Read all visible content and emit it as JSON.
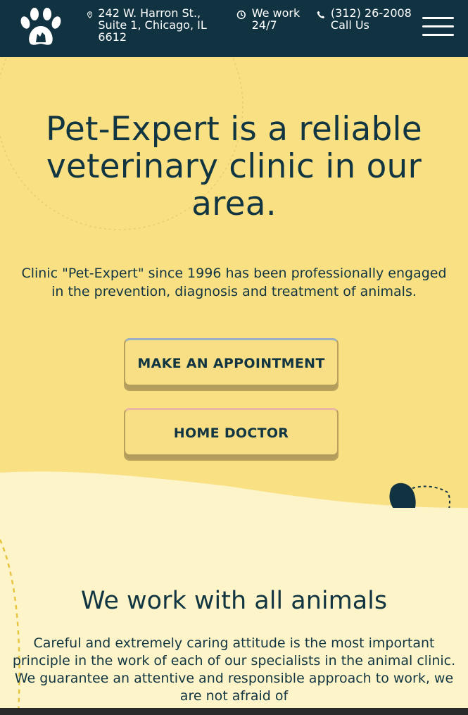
{
  "header": {
    "logo_icon": "paw-pets-logo",
    "address": "242 W. Harron St., Suite 1, Chicago, IL 6612",
    "hours": "We work 24/7",
    "phone": "(312) 26-2008 Call Us",
    "icons": {
      "address": "map-pin-icon",
      "hours": "clock-icon",
      "phone": "phone-icon",
      "menu": "hamburger-menu-icon"
    },
    "background": "#113341"
  },
  "hero": {
    "title": "Pet-Expert is a reliable veterinary clinic in our area.",
    "lead": "Clinic \"Pet-Expert\" since 1996 has been professionally engaged in the prevention, diagnosis and treatment of animals.",
    "buttons": {
      "appointment": "MAKE AN APPOINTMENT",
      "home_doctor": "HOME DOCTOR"
    },
    "background": "#f9e083"
  },
  "section": {
    "title": "We work with all animals",
    "body": "Careful and extremely caring attitude is the most important principle in the work of each of our specialists in the animal clinic. We guarantee an attentive and responsible approach to work, we are not afraid of",
    "background": "#fdf5c9"
  }
}
